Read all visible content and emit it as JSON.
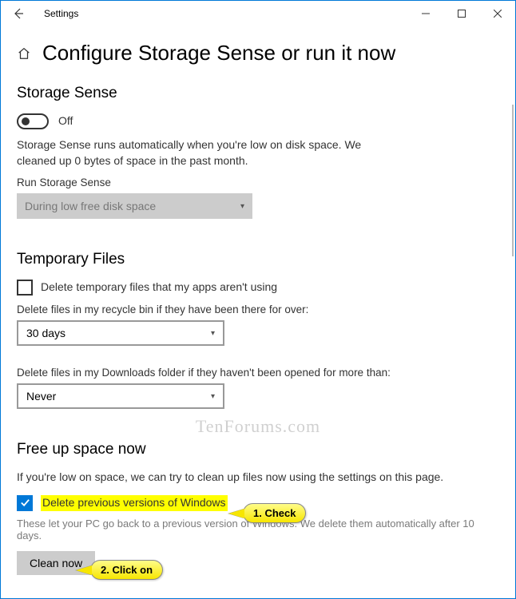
{
  "window": {
    "title": "Settings"
  },
  "header": {
    "title": "Configure Storage Sense or run it now"
  },
  "storage_sense": {
    "heading": "Storage Sense",
    "toggle_state": "Off",
    "description": "Storage Sense runs automatically when you're low on disk space. We cleaned up 0 bytes of space in the past month.",
    "run_label": "Run Storage Sense",
    "run_value": "During low free disk space"
  },
  "temp_files": {
    "heading": "Temporary Files",
    "delete_temp_label": "Delete temporary files that my apps aren't using",
    "recycle_label": "Delete files in my recycle bin if they have been there for over:",
    "recycle_value": "30 days",
    "downloads_label": "Delete files in my Downloads folder if they haven't been opened for more than:",
    "downloads_value": "Never"
  },
  "free_up": {
    "heading": "Free up space now",
    "intro": "If you're low on space, we can try to clean up files now using the settings on this page.",
    "prev_win_label": "Delete previous versions of Windows",
    "note": "These let your PC go back to a previous version of Windows. We delete them automatically after 10 days.",
    "clean_btn": "Clean now"
  },
  "callouts": {
    "check": "1. Check",
    "click": "2. Click on"
  },
  "watermark": "TenForums.com"
}
